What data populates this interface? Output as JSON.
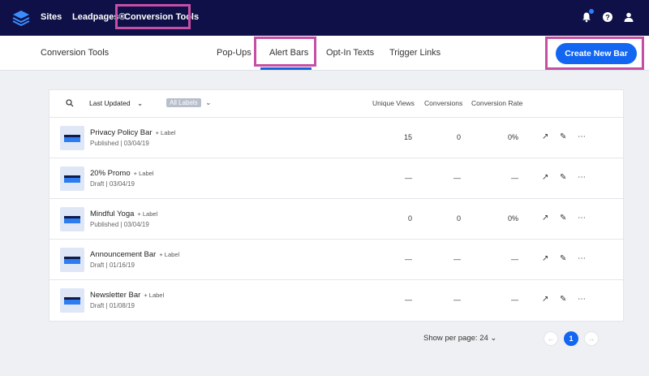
{
  "topnav": {
    "links": [
      "Sites",
      "Leadpages®",
      "Conversion Tools"
    ]
  },
  "subheader": {
    "title": "Conversion Tools",
    "tabs": [
      "Pop-Ups",
      "Alert Bars",
      "Opt-In Texts",
      "Trigger Links"
    ],
    "active_tab": "Alert Bars",
    "create_button": "Create New Bar"
  },
  "table": {
    "sort_label": "Last Updated",
    "filter_chip": "All Labels",
    "columns": [
      "Unique Views",
      "Conversions",
      "Conversion Rate"
    ],
    "rows": [
      {
        "name": "Privacy Policy Bar",
        "label": "+ Label",
        "status": "Published | 03/04/19",
        "views": "15",
        "conversions": "0",
        "rate": "0%"
      },
      {
        "name": "20% Promo",
        "label": "+ Label",
        "status": "Draft | 03/04/19",
        "views": "—",
        "conversions": "—",
        "rate": "—"
      },
      {
        "name": "Mindful Yoga",
        "label": "+ Label",
        "status": "Published | 03/04/19",
        "views": "0",
        "conversions": "0",
        "rate": "0%"
      },
      {
        "name": "Announcement Bar",
        "label": "+ Label",
        "status": "Draft | 01/16/19",
        "views": "—",
        "conversions": "—",
        "rate": "—"
      },
      {
        "name": "Newsletter Bar",
        "label": "+ Label",
        "status": "Draft | 01/08/19",
        "views": "—",
        "conversions": "—",
        "rate": "—"
      }
    ]
  },
  "pagination": {
    "per_page_label": "Show per page:",
    "per_page_value": "24",
    "current_page": "1"
  },
  "colors": {
    "nav_bg": "#0e1047",
    "accent": "#1266f1",
    "highlight": "#c64fa6"
  }
}
